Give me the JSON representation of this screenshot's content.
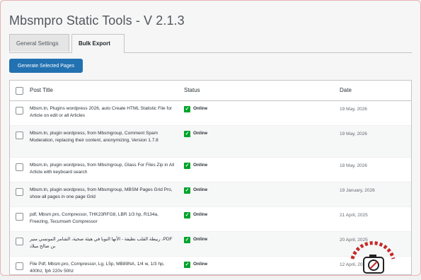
{
  "app": {
    "title": "Mbsmpro Static Tools - V 2.1.3"
  },
  "tabs": [
    {
      "label": "General Settings"
    },
    {
      "label": "Bulk Export"
    }
  ],
  "actions": {
    "generate_label": "Generate Selected Pages"
  },
  "table": {
    "columns": {
      "title": "Post Title",
      "status": "Status",
      "date": "Date"
    },
    "rows": [
      {
        "title": "Mbsm.tn, Plugins wordpress 2026, auto Create HTML Statistic File for Article on edit or all Articles",
        "status": "Online",
        "date": "19 May, 2026"
      },
      {
        "title": "Mbsm.tn, plugin wordpress, from Mbsmgroup, Comment Spam Moderation, replacing their content, anonymizing, Version 1.7.8",
        "status": "Online",
        "date": "19 May, 2026"
      },
      {
        "title": "Mbsm.tn, plugin wordpress, from Mbsmgroup, Glass For Files Zip in All Article with keyboard search",
        "status": "Online",
        "date": "18 May, 2026"
      },
      {
        "title": "Mbsm.tn, plugin wordpress, from Mbsmgroup, MBSM Pages Grid Pro, show all pages in one page Grid",
        "status": "Online",
        "date": "19 January, 2026"
      },
      {
        "title": "pdf, Mbsm.pro, Compressor, THK23RFG8, LBR 1/3 hp, R134a, Freezing, Tecumseh Compressor",
        "status": "Online",
        "date": "21 April, 2025"
      },
      {
        "title": "PDF، ربيطة القلب نظيفة - الأنها النوبا في هيئة صحية، الشامر المونسي منير بن صالح ميلاد",
        "status": "Online",
        "date": "20 April, 2025"
      },
      {
        "title": "File Pdf, Mbsm.pro, Compressor, Lg, L5p, MB89NA, 1/4 w, 1/3 hp, 400hz, fph 220v 50hz",
        "status": "Online",
        "date": "12 April, 2025"
      }
    ]
  },
  "colors": {
    "primary": "#2271b1",
    "online": "#00a32a",
    "watermark": "#c62828"
  }
}
